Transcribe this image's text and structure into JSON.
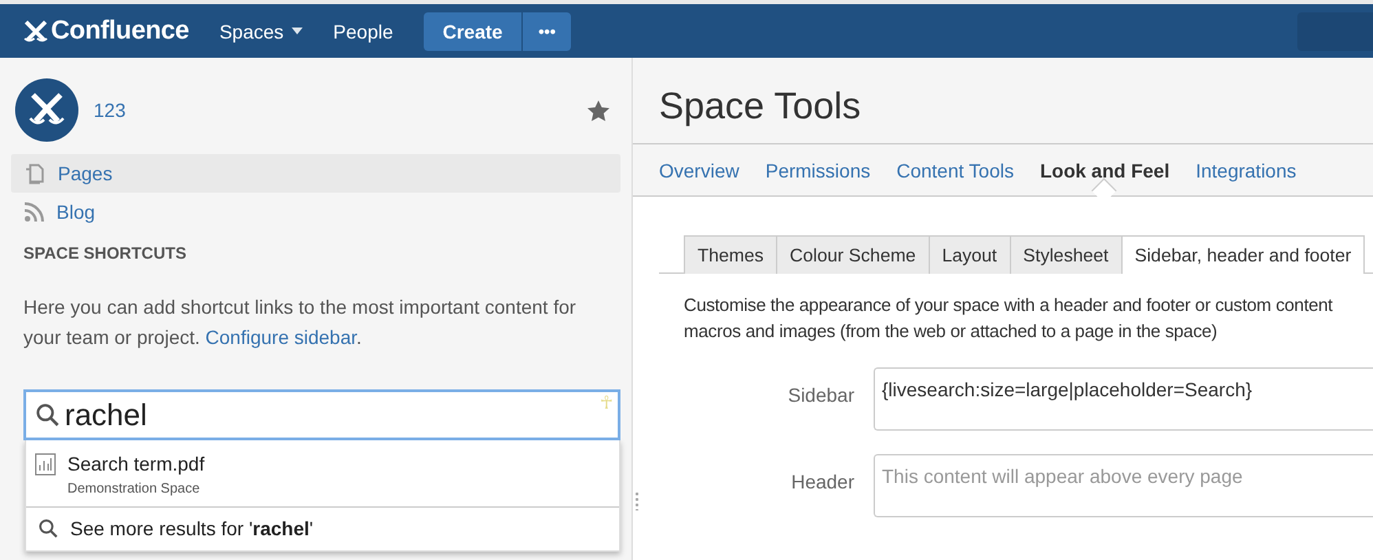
{
  "header": {
    "logo": "Confluence",
    "nav": [
      {
        "label": "Spaces",
        "dropdown": true
      },
      {
        "label": "People",
        "dropdown": false
      }
    ],
    "create": "Create",
    "more": "•••"
  },
  "sidebar": {
    "space_name": "123",
    "starred": true,
    "items": [
      {
        "label": "Pages",
        "kind": "pages",
        "selected": true
      },
      {
        "label": "Blog",
        "kind": "blog",
        "selected": false
      }
    ],
    "shortcuts_title": "SPACE SHORTCUTS",
    "shortcuts_text": "Here you can add shortcut links to the most important content for your team or project.",
    "configure_link": "Configure sidebar",
    "after_link": ".",
    "search": {
      "value": "rachel",
      "extension_glyph": "☥"
    },
    "results": [
      {
        "title": "Search term.pdf",
        "subtitle": "Demonstration Space"
      }
    ],
    "more_results": "See more results for '**rachel**'"
  },
  "main": {
    "title": "Space Tools",
    "tabs": [
      {
        "label": "Overview",
        "selected": false
      },
      {
        "label": "Permissions",
        "selected": false
      },
      {
        "label": "Content Tools",
        "selected": false
      },
      {
        "label": "Look and Feel",
        "selected": true
      },
      {
        "label": "Integrations",
        "selected": false
      }
    ],
    "subtabs": [
      {
        "label": "Themes",
        "selected": false
      },
      {
        "label": "Colour Scheme",
        "selected": false
      },
      {
        "label": "Layout",
        "selected": false
      },
      {
        "label": "Stylesheet",
        "selected": false
      },
      {
        "label": "Sidebar, header and footer",
        "selected": true
      }
    ],
    "description": "Customise the appearance of your space with a header and footer or custom content macros and images (from the web or attached to a page in the space)",
    "fields": [
      {
        "label": "Sidebar",
        "value": "{livesearch:size=large|placeholder=Search}"
      },
      {
        "label": "Header",
        "placeholder": "This content will appear above every page"
      }
    ]
  }
}
